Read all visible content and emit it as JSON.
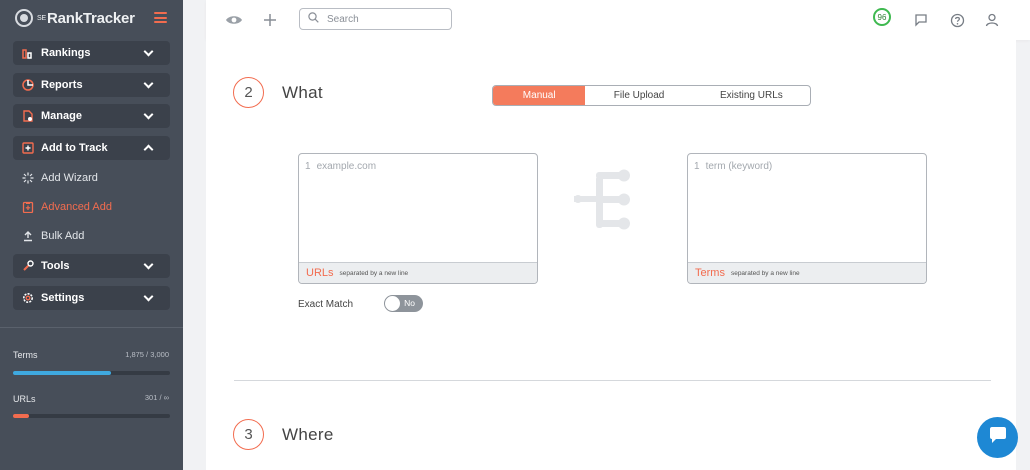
{
  "brand": {
    "prefix": "SE",
    "name": "RankTracker"
  },
  "sidebar": {
    "menu": [
      {
        "label": "Rankings",
        "icon": "rankings-icon"
      },
      {
        "label": "Reports",
        "icon": "reports-icon"
      },
      {
        "label": "Manage",
        "icon": "manage-icon"
      },
      {
        "label": "Add to Track",
        "icon": "add-to-track-icon"
      },
      {
        "label": "Tools",
        "icon": "tools-icon"
      },
      {
        "label": "Settings",
        "icon": "gear-icon"
      }
    ],
    "submenu": [
      {
        "label": "Add Wizard",
        "icon": "wizard-icon"
      },
      {
        "label": "Advanced Add",
        "icon": "advanced-add-icon"
      },
      {
        "label": "Bulk Add",
        "icon": "bulk-add-icon"
      }
    ],
    "usage": {
      "terms": {
        "label": "Terms",
        "value": "1,875 / 3,000",
        "fraction": 0.625
      },
      "urls": {
        "label": "URLs",
        "value": "301 / ∞",
        "fraction": 0.1
      }
    }
  },
  "topbar": {
    "search_placeholder": "Search",
    "score": "96"
  },
  "step2": {
    "number": "2",
    "title": "What",
    "tabs": [
      "Manual",
      "File Upload",
      "Existing URLs"
    ],
    "active_tab": "Manual",
    "urls_box": {
      "line_number": "1",
      "placeholder": "example.com",
      "label": "URLs",
      "hint": "separated by a new line"
    },
    "terms_box": {
      "line_number": "1",
      "placeholder": "term (keyword)",
      "label": "Terms",
      "hint": "separated by a new line"
    },
    "exact_match": {
      "label": "Exact Match",
      "state": "No"
    }
  },
  "step3": {
    "number": "3",
    "title": "Where"
  },
  "colors": {
    "accent": "#f26c4f",
    "sidebar": "#474e59",
    "terms_bar": "#3fa9e0",
    "chat": "#1e88d4"
  }
}
